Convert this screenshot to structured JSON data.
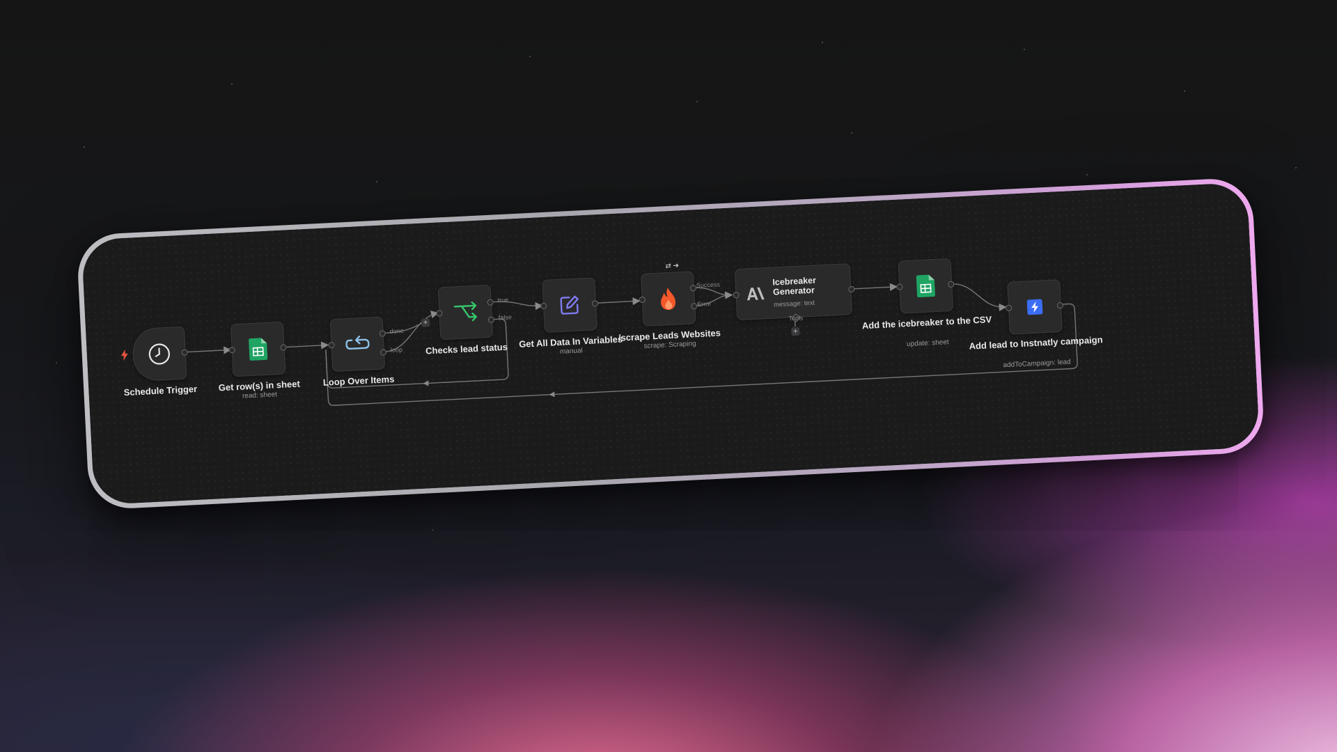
{
  "nodes": {
    "schedule_trigger": {
      "label": "Schedule Trigger",
      "icon": "clock-icon"
    },
    "get_rows": {
      "label": "Get row(s) in sheet",
      "sub": "read: sheet",
      "icon": "google-sheets-icon"
    },
    "loop": {
      "label": "Loop Over Items",
      "icon": "loop-icon",
      "out_done": "done",
      "out_loop": "loop"
    },
    "checks": {
      "label": "Checks lead status",
      "icon": "if-branch-icon",
      "out_true": "true",
      "out_false": "false"
    },
    "variables": {
      "label": "Get All Data In Variables",
      "sub": "manual",
      "icon": "edit-icon"
    },
    "scrape": {
      "label": "/scrape Leads Websites",
      "sub": "scrape: Scraping",
      "icon": "firecrawl-icon",
      "out_success": "Success",
      "out_error": "Error"
    },
    "icebreaker": {
      "title": "Icebreaker Generator",
      "sub": "message: text",
      "icon": "anthropic-icon",
      "tools": "Tools"
    },
    "add_csv": {
      "label": "Add the icebreaker to the CSV",
      "sub": "update: sheet",
      "icon": "google-sheets-icon"
    },
    "instantly": {
      "label": "Add lead to Instnatly campaign",
      "sub": "addToCampaign: lead",
      "icon": "instantly-icon"
    }
  },
  "colors": {
    "sheets_green": "#1fa463",
    "if_green": "#35c76a",
    "edit_purple": "#7f7cf0",
    "fire_orange": "#f5582a",
    "instantly_blue": "#3b6ef6",
    "trigger_red": "#e5533d",
    "loop_blue": "#8ec3e8"
  }
}
